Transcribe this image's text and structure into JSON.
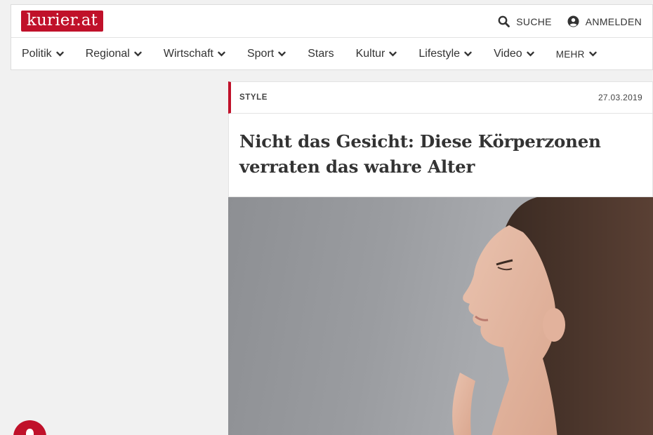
{
  "header": {
    "logo_text": "kurier.at",
    "search_label": "SUCHE",
    "login_label": "ANMELDEN",
    "brand_color": "#c0112a"
  },
  "nav": {
    "items": [
      {
        "label": "Politik",
        "dropdown": true
      },
      {
        "label": "Regional",
        "dropdown": true
      },
      {
        "label": "Wirtschaft",
        "dropdown": true
      },
      {
        "label": "Sport",
        "dropdown": true
      },
      {
        "label": "Stars",
        "dropdown": false
      },
      {
        "label": "Kultur",
        "dropdown": true
      },
      {
        "label": "Lifestyle",
        "dropdown": true
      },
      {
        "label": "Video",
        "dropdown": true
      },
      {
        "label": "MEHR",
        "dropdown": true
      }
    ]
  },
  "article": {
    "category": "STYLE",
    "date": "27.03.2019",
    "title": "Nicht das Gesicht: Diese Körperzonen verraten das wahre Alter"
  },
  "icons": {
    "search": "search-icon",
    "user": "user-circle-icon",
    "chevron": "chevron-down-icon",
    "notification": "bell-icon"
  }
}
